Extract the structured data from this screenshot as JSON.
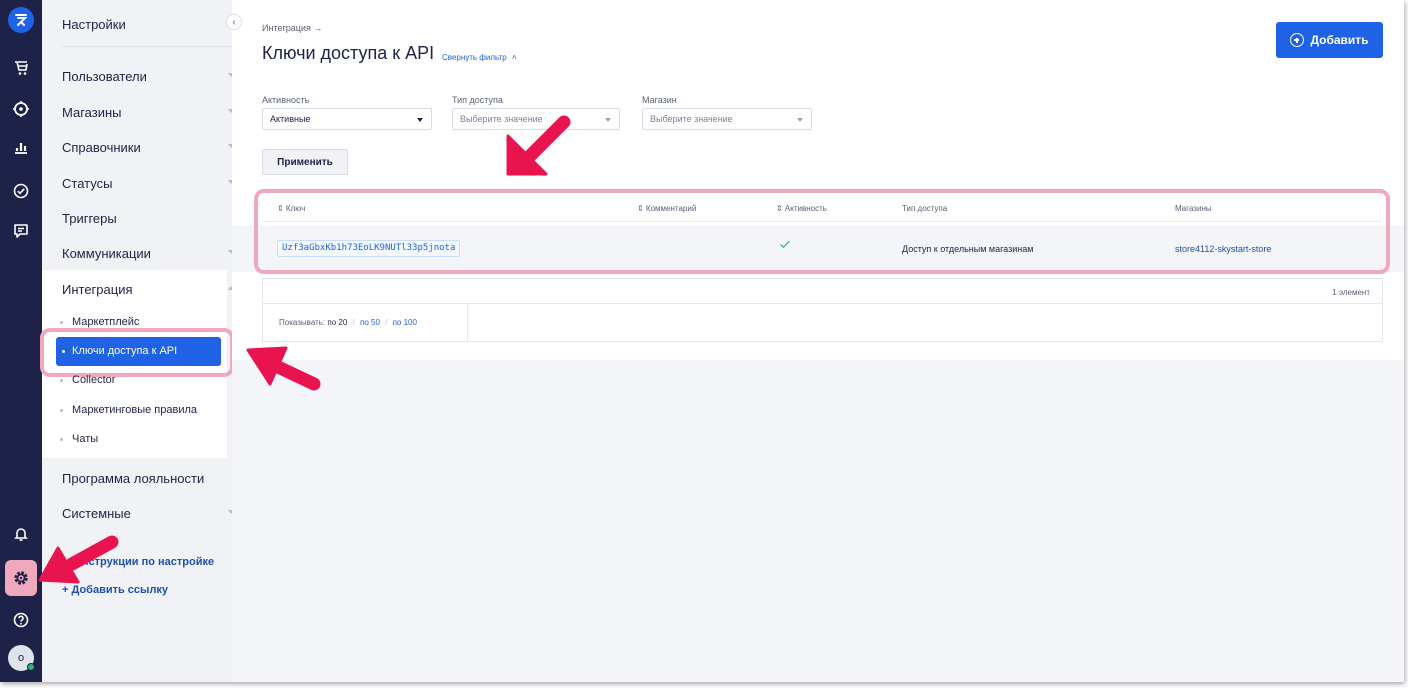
{
  "sidebar": {
    "title": "Настройки",
    "items": [
      {
        "label": "Пользователи"
      },
      {
        "label": "Магазины"
      },
      {
        "label": "Справочники"
      },
      {
        "label": "Статусы"
      },
      {
        "label": "Триггеры"
      },
      {
        "label": "Коммуникации"
      },
      {
        "label": "Интеграция"
      },
      {
        "label": "Программа лояльности"
      },
      {
        "label": "Системные"
      }
    ],
    "integration_sub": [
      {
        "label": "Маркетплейс"
      },
      {
        "label": "Ключи доступа к API"
      },
      {
        "label": "Collector"
      },
      {
        "label": "Маркетинговые правила"
      },
      {
        "label": "Чаты"
      }
    ],
    "links": {
      "instructions": "Инструкции по настройке",
      "add_link": "+ Добавить ссылку"
    }
  },
  "rail": {
    "avatar_letter": "о",
    "icons": [
      "logo-icon",
      "cart-icon",
      "target-icon",
      "analytics-icon",
      "check-circle-icon",
      "chat-icon",
      "bell-icon",
      "gear-icon",
      "help-icon"
    ]
  },
  "header": {
    "breadcrumb": "Интеграция →",
    "title": "Ключи доступа к API",
    "filter_toggle": "Свернуть фильтр",
    "add_button": "Добавить"
  },
  "filters": {
    "activity": {
      "label": "Активность",
      "value": "Активные"
    },
    "access_type": {
      "label": "Тип доступа",
      "placeholder": "Выберите значение"
    },
    "store": {
      "label": "Магазин",
      "placeholder": "Выберите значение"
    },
    "apply": "Применить"
  },
  "table": {
    "columns": {
      "key": "⇕ Ключ",
      "comment": "⇕ Комментарий",
      "active": "⇕ Активность",
      "access": "Тип доступа",
      "stores": "Магазины"
    },
    "rows": [
      {
        "key": "Uzf3aGbxKb1h73EoLK9NUTl33p5jnota",
        "comment": "",
        "active": true,
        "access": "Доступ к отдельным магазинам",
        "stores": "store4112-skystart-store"
      }
    ],
    "count": "1 элемент",
    "pager": {
      "label": "Показывать:",
      "opt20": "по 20",
      "opt50": "по 50",
      "opt100": "по 100"
    }
  },
  "colors": {
    "rail": "#1e2248",
    "accent": "#1f62e6",
    "annotation": "#e8134f",
    "highlight": "#f0a8bd"
  }
}
